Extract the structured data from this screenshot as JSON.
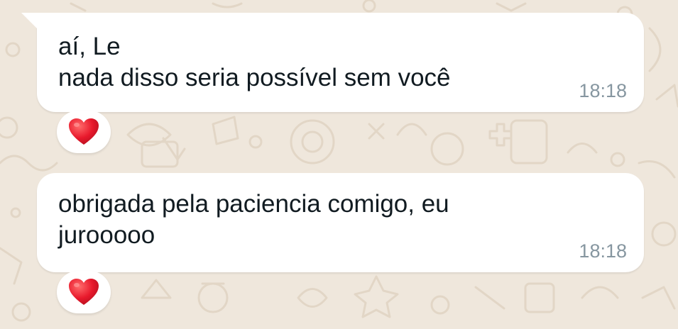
{
  "chat": {
    "background_color": "#efe7dc",
    "bubble_color": "#ffffff",
    "messages": [
      {
        "text": "aí, Le\nnada disso seria possível sem você",
        "time": "18:18",
        "reaction": "red-heart-icon"
      },
      {
        "text": "obrigada pela paciencia comigo, eu\njurooooo",
        "time": "18:18",
        "reaction": "red-heart-icon"
      }
    ]
  }
}
